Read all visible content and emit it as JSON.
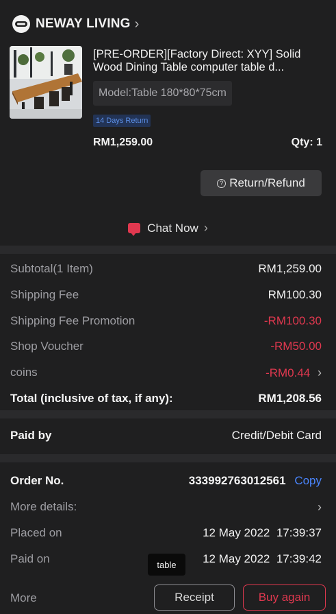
{
  "shop": {
    "name": "NEWAY LIVING",
    "chevron": "›"
  },
  "product": {
    "title_line1": "[PRE-ORDER][Factory Direct: XYY] Solid",
    "title_line2": "Wood Dining Table computer table d...",
    "model": "Model:Table 180*80*75cm",
    "badge": "14 Days Return",
    "price": "RM1,259.00",
    "qty": "Qty: 1"
  },
  "return_refund": {
    "icon": "?",
    "label": "Return/Refund"
  },
  "chat": {
    "label": "Chat Now",
    "chevron": "›"
  },
  "summary": {
    "subtotal_label": "Subtotal(1 Item)",
    "subtotal_value": "RM1,259.00",
    "shipping_label": "Shipping Fee",
    "shipping_value": "RM100.30",
    "ship_promo_label": "Shipping Fee Promotion",
    "ship_promo_value": "-RM100.30",
    "voucher_label": "Shop Voucher",
    "voucher_value": "-RM50.00",
    "coins_label": "coins",
    "coins_value": "-RM0.44",
    "coins_chevron": "›",
    "total_label": "Total (inclusive of tax, if any):",
    "total_value": "RM1,208.56"
  },
  "payment": {
    "label": "Paid by",
    "value": "Credit/Debit Card"
  },
  "order": {
    "no_label": "Order No.",
    "no_value": "333992763012561",
    "copy_label": "Copy",
    "more_details_label": "More details:",
    "more_details_chevron": "›",
    "placed_label": "Placed on",
    "placed_value": "12 May 2022  17:39:37",
    "paid_label": "Paid on",
    "paid_value": "12 May 2022  17:39:42"
  },
  "tooltip": "table",
  "footer": {
    "more_label": "More",
    "receipt_label": "Receipt",
    "buy_again_label": "Buy again"
  },
  "colors": {
    "accent_red": "#e0384f",
    "link_blue": "#4a86ff",
    "badge_blue": "#5c8fe6"
  }
}
